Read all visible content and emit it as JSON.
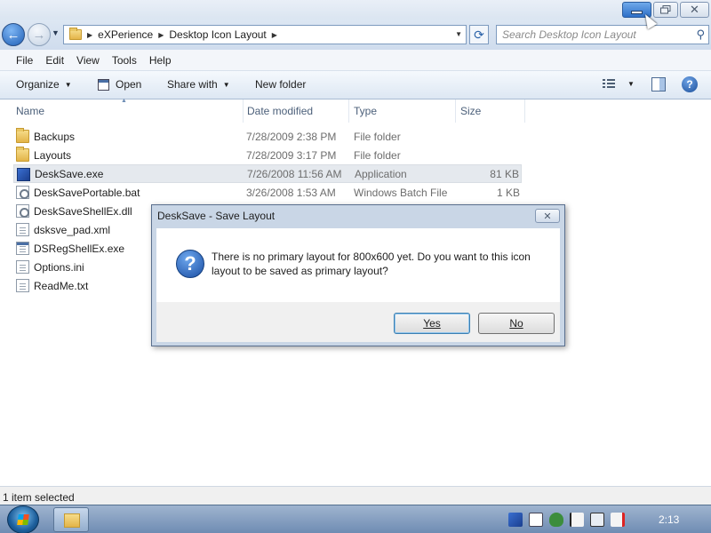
{
  "window": {
    "minimize_icon": "minimize-icon",
    "maximize_icon": "restore-icon",
    "close_glyph": "✕"
  },
  "address": {
    "back_glyph": "←",
    "forward_glyph": "→",
    "crumbs": [
      "eXPerience",
      "Desktop Icon Layout"
    ],
    "search_placeholder": "Search Desktop Icon Layout"
  },
  "menu": {
    "items": [
      "File",
      "Edit",
      "View",
      "Tools",
      "Help"
    ]
  },
  "toolbar": {
    "organize": "Organize",
    "open": "Open",
    "share_with": "Share with",
    "new_folder": "New folder",
    "help_glyph": "?"
  },
  "columns": {
    "name": "Name",
    "date": "Date modified",
    "type": "Type",
    "size": "Size"
  },
  "files": [
    {
      "name": "Backups",
      "date": "7/28/2009 2:38 PM",
      "type": "File folder",
      "size": "",
      "icon": "folder-icon"
    },
    {
      "name": "Layouts",
      "date": "7/28/2009 3:17 PM",
      "type": "File folder",
      "size": "",
      "icon": "folder-icon"
    },
    {
      "name": "DeskSave.exe",
      "date": "7/26/2008 11:56 AM",
      "type": "Application",
      "size": "81 KB",
      "icon": "application-icon"
    },
    {
      "name": "DeskSavePortable.bat",
      "date": "3/26/2008 1:53 AM",
      "type": "Windows Batch File",
      "size": "1 KB",
      "icon": "batch-file-icon"
    },
    {
      "name": "DeskSaveShellEx.dll",
      "date": "",
      "type": "",
      "size": "",
      "icon": "dll-file-icon"
    },
    {
      "name": "dsksve_pad.xml",
      "date": "",
      "type": "",
      "size": "",
      "icon": "xml-file-icon"
    },
    {
      "name": "DSRegShellEx.exe",
      "date": "",
      "type": "",
      "size": "",
      "icon": "application-icon"
    },
    {
      "name": "Options.ini",
      "date": "",
      "type": "",
      "size": "",
      "icon": "settings-file-icon"
    },
    {
      "name": "ReadMe.txt",
      "date": "",
      "type": "",
      "size": "",
      "icon": "text-file-icon"
    }
  ],
  "dialog": {
    "title": "DeskSave - Save Layout",
    "message": "There is no primary layout for 800x600 yet. Do you want to this icon layout to be saved as primary layout?",
    "yes": "Yes",
    "no": "No",
    "icon_glyph": "?",
    "close_glyph": "✕"
  },
  "status": {
    "text": "1 item selected"
  },
  "taskbar": {
    "clock": "2:13"
  },
  "colors": {
    "accent": "#2e6fc7",
    "selection": "#e5e9ee"
  }
}
